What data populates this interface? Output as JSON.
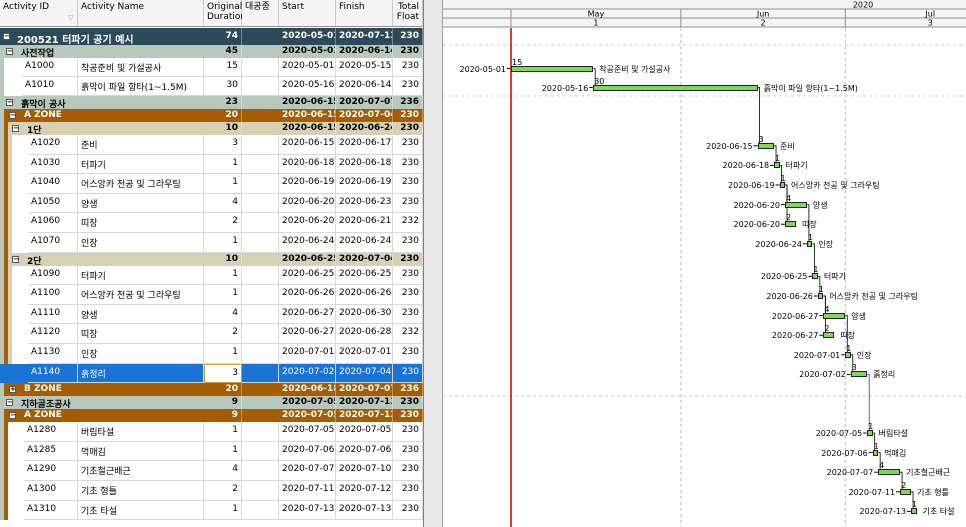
{
  "columns": {
    "activity_id": "Activity ID",
    "activity_name": "Activity Name",
    "orig_duration": [
      "Original",
      "Duration"
    ],
    "daegongjong": "대공종",
    "start": "Start",
    "finish": "Finish",
    "total_float": [
      "Total",
      "Float"
    ]
  },
  "timescale": {
    "year": "2020",
    "months": [
      "May",
      "Jun",
      "Jul"
    ],
    "weeks": [
      "1",
      "2",
      "3"
    ]
  },
  "colors": {
    "project_band": "#2d4a5a",
    "wbs1_band": "#b8c8bc",
    "zone_band": "#a65c00",
    "dan_band": "#d8d0b4",
    "selected": "#1874d6",
    "bar_fill": "#7ed957",
    "data_date": "#cc0000"
  },
  "rows": [
    {
      "kind": "project",
      "id": "200521 터파기 공기 예시",
      "dur": "74",
      "start": "2020-05-01",
      "finish": "2020-07-13",
      "tf": "230"
    },
    {
      "kind": "wbs1",
      "id": "사전작업",
      "dur": "45",
      "start": "2020-05-01",
      "finish": "2020-06-14",
      "tf": "230"
    },
    {
      "kind": "act",
      "id": "A1000",
      "name": "착공준비 및 가설공사",
      "dur": "15",
      "start": "2020-05-01",
      "finish": "2020-05-15",
      "tf": "230"
    },
    {
      "kind": "act",
      "id": "A1010",
      "name": "흙막이 파일 항타(1~1.5M)",
      "dur": "30",
      "start": "2020-05-16",
      "finish": "2020-06-14",
      "tf": "230"
    },
    {
      "kind": "wbs1",
      "id": "흙막이 공사",
      "dur": "23",
      "start": "2020-06-15",
      "finish": "2020-07-07",
      "tf": "236"
    },
    {
      "kind": "zone",
      "id": "A ZONE",
      "dur": "20",
      "start": "2020-06-15",
      "finish": "2020-07-04",
      "tf": "230"
    },
    {
      "kind": "dan",
      "id": "1단",
      "dur": "10",
      "start": "2020-06-15",
      "finish": "2020-06-24",
      "tf": "230"
    },
    {
      "kind": "act2",
      "id": "A1020",
      "name": "준비",
      "dur": "3",
      "start": "2020-06-15",
      "finish": "2020-06-17",
      "tf": "230"
    },
    {
      "kind": "act2",
      "id": "A1030",
      "name": "터파기",
      "dur": "1",
      "start": "2020-06-18",
      "finish": "2020-06-18",
      "tf": "230"
    },
    {
      "kind": "act2",
      "id": "A1040",
      "name": "어스앙카 천공 및 그라우팅",
      "dur": "1",
      "start": "2020-06-19",
      "finish": "2020-06-19",
      "tf": "230"
    },
    {
      "kind": "act2",
      "id": "A1050",
      "name": "양생",
      "dur": "4",
      "start": "2020-06-20",
      "finish": "2020-06-23",
      "tf": "230"
    },
    {
      "kind": "act2",
      "id": "A1060",
      "name": "띠장",
      "dur": "2",
      "start": "2020-06-20",
      "finish": "2020-06-21",
      "tf": "232"
    },
    {
      "kind": "act2",
      "id": "A1070",
      "name": "인장",
      "dur": "1",
      "start": "2020-06-24",
      "finish": "2020-06-24",
      "tf": "230"
    },
    {
      "kind": "dan",
      "id": "2단",
      "dur": "10",
      "start": "2020-06-25",
      "finish": "2020-07-04",
      "tf": "230"
    },
    {
      "kind": "act2",
      "id": "A1090",
      "name": "터파기",
      "dur": "1",
      "start": "2020-06-25",
      "finish": "2020-06-25",
      "tf": "230"
    },
    {
      "kind": "act2",
      "id": "A1100",
      "name": "어스앙카 천공 및 그라우팅",
      "dur": "1",
      "start": "2020-06-26",
      "finish": "2020-06-26",
      "tf": "230"
    },
    {
      "kind": "act2",
      "id": "A1110",
      "name": "양생",
      "dur": "4",
      "start": "2020-06-27",
      "finish": "2020-06-30",
      "tf": "230"
    },
    {
      "kind": "act2",
      "id": "A1120",
      "name": "띠장",
      "dur": "2",
      "start": "2020-06-27",
      "finish": "2020-06-28",
      "tf": "232"
    },
    {
      "kind": "act2",
      "id": "A1130",
      "name": "인장",
      "dur": "1",
      "start": "2020-07-01",
      "finish": "2020-07-01",
      "tf": "230"
    },
    {
      "kind": "act2",
      "id": "A1140",
      "name": "흙정리",
      "dur": "3",
      "start": "2020-07-02",
      "finish": "2020-07-04",
      "tf": "230",
      "selected": true
    },
    {
      "kind": "zone",
      "id": "B ZONE",
      "dur": "20",
      "start": "2020-06-18",
      "finish": "2020-07-07",
      "tf": "236",
      "collapsed": true
    },
    {
      "kind": "wbs1",
      "id": "지하골조공사",
      "dur": "9",
      "start": "2020-07-05",
      "finish": "2020-07-13",
      "tf": "230"
    },
    {
      "kind": "zone",
      "id": "A ZONE",
      "dur": "9",
      "start": "2020-07-05",
      "finish": "2020-07-13",
      "tf": "230"
    },
    {
      "kind": "act3",
      "id": "A1280",
      "name": "버림타설",
      "dur": "1",
      "start": "2020-07-05",
      "finish": "2020-07-05",
      "tf": "230"
    },
    {
      "kind": "act3",
      "id": "A1285",
      "name": "먹매김",
      "dur": "1",
      "start": "2020-07-06",
      "finish": "2020-07-06",
      "tf": "230"
    },
    {
      "kind": "act3",
      "id": "A1290",
      "name": "기초철근배근",
      "dur": "4",
      "start": "2020-07-07",
      "finish": "2020-07-10",
      "tf": "230"
    },
    {
      "kind": "act3",
      "id": "A1300",
      "name": "기초 형틀",
      "dur": "2",
      "start": "2020-07-11",
      "finish": "2020-07-12",
      "tf": "230"
    },
    {
      "kind": "act3",
      "id": "A1310",
      "name": "기초 타설",
      "dur": "1",
      "start": "2020-07-13",
      "finish": "2020-07-13",
      "tf": "230"
    }
  ]
}
